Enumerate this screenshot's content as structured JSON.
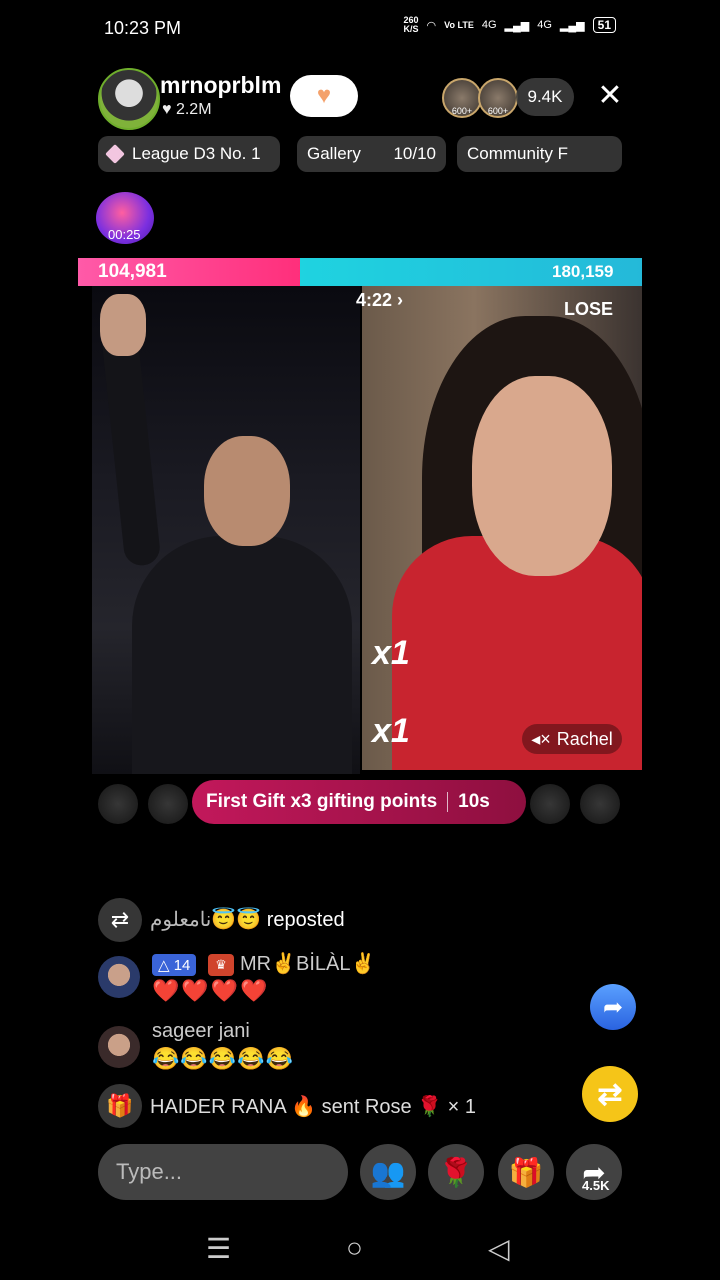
{
  "status": {
    "time": "10:23 PM",
    "net_speed_value": "260",
    "net_speed_unit": "K/S",
    "volte": "Vo LTE",
    "network_1": "4G",
    "network_2": "4G",
    "battery": "51"
  },
  "header": {
    "host_name": "mrnoprblm",
    "host_likes": "♥ 2.2M",
    "follow_glyph": "♥",
    "viewer_badges": [
      "600+",
      "600+"
    ],
    "viewer_count": "9.4K",
    "close_glyph": "✕"
  },
  "chips": {
    "league": "League D3 No. 1",
    "gallery_label": "Gallery",
    "gallery_count": "10/10",
    "community": "Community F"
  },
  "boost": {
    "time": "00:25"
  },
  "battle": {
    "left_score": "104,981",
    "right_score": "180,159",
    "timer": "4:22",
    "result_right": "LOSE",
    "multiplier_1": "x1",
    "multiplier_2": "x1",
    "opponent_name": "Rachel"
  },
  "gift_banner": {
    "text": "First Gift x3 gifting points",
    "countdown": "10s"
  },
  "chat": [
    {
      "type": "repost",
      "user": "نامعلوم😇😇",
      "text": "reposted"
    },
    {
      "type": "message",
      "level": "14",
      "user": "MR✌️BİLÀL✌️",
      "text": "❤️❤️❤️❤️"
    },
    {
      "type": "message",
      "user": "sageer jani",
      "text": "😂😂😂😂😂"
    },
    {
      "type": "gift",
      "text": "HAIDER RANA 🔥 sent Rose 🌹 × 1"
    }
  ],
  "bottom_bar": {
    "input_placeholder": "Type...",
    "share_count": "4.5K"
  },
  "colors": {
    "battle_left": "#ff2f7b",
    "battle_right": "#24b9d9",
    "gift_banner": "#c2185b",
    "repost_button": "#f5c518",
    "share_button": "#2a63e0"
  }
}
